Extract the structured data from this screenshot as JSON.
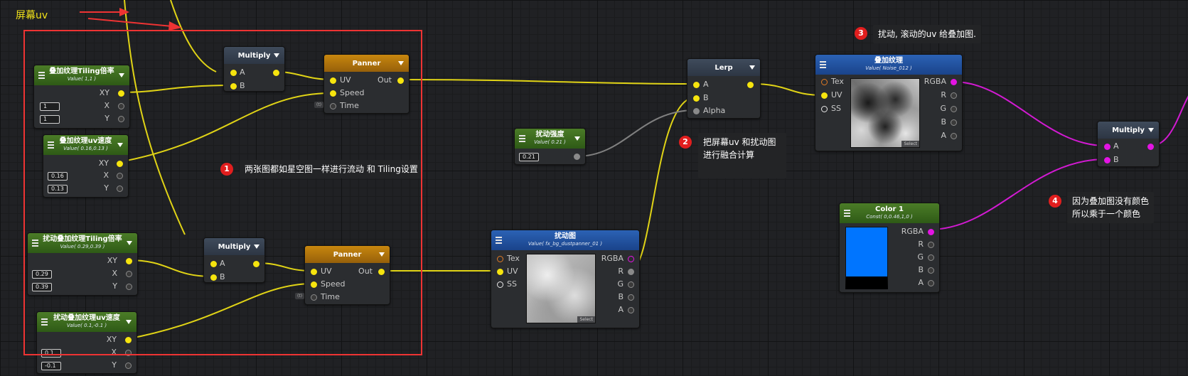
{
  "label": {
    "screen_uv": "屏幕uv"
  },
  "nodes": {
    "tiling1": {
      "title": "叠加纹理Tiling倍率",
      "sub": "Value( 1,1 )",
      "xy": "XY",
      "x": "X",
      "y": "Y",
      "xv": "1",
      "yv": "1"
    },
    "speed1": {
      "title": "叠加纹理uv速度",
      "sub": "Value( 0.16,0.13 )",
      "xy": "XY",
      "x": "X",
      "y": "Y",
      "xv": "0.16",
      "yv": "0.13"
    },
    "tiling2": {
      "title": "扰动叠加纹理Tiling倍率",
      "sub": "Value( 0.29,0.39 )",
      "xy": "XY",
      "x": "X",
      "y": "Y",
      "xv": "0.29",
      "yv": "0.39"
    },
    "speed2": {
      "title": "扰动叠加纹理uv速度",
      "sub": "Value( 0.1,-0.1 )",
      "xy": "XY",
      "x": "X",
      "y": "Y",
      "xv": "0.1",
      "yv": "-0.1"
    },
    "mul1": {
      "title": "Multiply",
      "a": "A",
      "b": "B"
    },
    "mul2": {
      "title": "Multiply",
      "a": "A",
      "b": "B"
    },
    "mul3": {
      "title": "Multiply",
      "a": "A",
      "b": "B"
    },
    "pan1": {
      "title": "Panner",
      "uv": "UV",
      "speed": "Speed",
      "time": "Time",
      "out": "Out",
      "tag": "(t)"
    },
    "pan2": {
      "title": "Panner",
      "uv": "UV",
      "speed": "Speed",
      "time": "Time",
      "out": "Out",
      "tag": "(t)"
    },
    "strength": {
      "title": "扰动强度",
      "sub": "Value( 0.21 )",
      "v": "0.21"
    },
    "distort": {
      "title": "扰动图",
      "sub": "Value( fx_bg_dustpanner_01 )",
      "tex": "Tex",
      "uv": "UV",
      "ss": "SS",
      "rgba": "RGBA",
      "r": "R",
      "g": "G",
      "b": "B",
      "a": "A",
      "select": "Select"
    },
    "lerp": {
      "title": "Lerp",
      "a": "A",
      "b": "B",
      "alpha": "Alpha"
    },
    "overlay": {
      "title": "叠加纹理",
      "sub": "Value( Noise_012 )",
      "tex": "Tex",
      "uv": "UV",
      "ss": "SS",
      "rgba": "RGBA",
      "r": "R",
      "g": "G",
      "b": "B",
      "a": "A",
      "select": "Select"
    },
    "color1": {
      "title": "Color 1",
      "sub": "Const( 0,0.46,1,0 )",
      "rgba": "RGBA",
      "r": "R",
      "g": "G",
      "b": "B",
      "a": "A"
    }
  },
  "notes": {
    "n1": {
      "badge": "1",
      "text": "两张图都如星空图一样进行流动 和 Tiling设置"
    },
    "n2": {
      "badge": "2",
      "line1": "把屏幕uv 和扰动图",
      "line2": "进行融合计算"
    },
    "n3": {
      "badge": "3",
      "text": "扰动, 滚动的uv 给叠加图."
    },
    "n4": {
      "badge": "4",
      "line1": "因为叠加图没有颜色",
      "line2": "所以乘于一个颜色"
    }
  },
  "colors": {
    "wire_yellow": "#e8dc1a",
    "wire_magenta": "#d21ad2",
    "wire_gray": "#7a7a7a",
    "frame_red": "#e33333",
    "color1_swatch": "#0075ff"
  }
}
